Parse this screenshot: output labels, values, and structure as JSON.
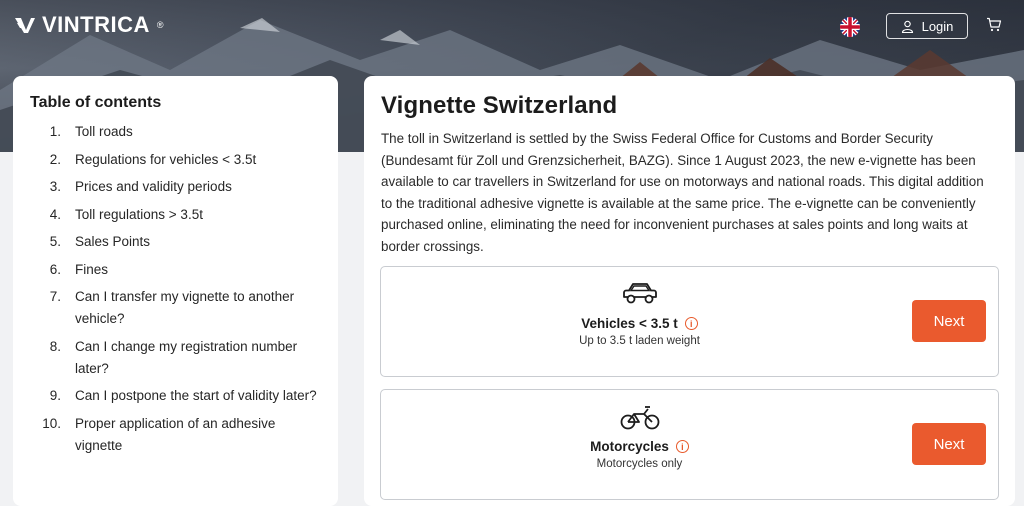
{
  "header": {
    "logo_text": "VINTRICA",
    "logo_mark": "®",
    "login_label": "Login",
    "icons": [
      "vintrica-logo-icon",
      "uk-flag-icon",
      "user-icon",
      "cart-icon"
    ]
  },
  "toc": {
    "title": "Table of contents",
    "items": [
      {
        "num": "1.",
        "label": "Toll roads"
      },
      {
        "num": "2.",
        "label": "Regulations for vehicles < 3.5t"
      },
      {
        "num": "3.",
        "label": "Prices and validity periods"
      },
      {
        "num": "4.",
        "label": "Toll regulations > 3.5t"
      },
      {
        "num": "5.",
        "label": "Sales Points"
      },
      {
        "num": "6.",
        "label": "Fines"
      },
      {
        "num": "7.",
        "label": "Can I transfer my vignette to another vehicle?"
      },
      {
        "num": "8.",
        "label": "Can I change my registration number later?"
      },
      {
        "num": "9.",
        "label": "Can I postpone the start of validity later?"
      },
      {
        "num": "10.",
        "label": "Proper application of an adhesive vignette"
      }
    ]
  },
  "main": {
    "title": "Vignette Switzerland",
    "intro": "The toll in Switzerland is settled by the Swiss Federal Office for Customs and Border Security (Bundesamt für Zoll und Grenzsicherheit, BAZG). Since 1 August 2023, the new e-vignette has been available to car travellers in Switzerland for use on motorways and national roads. This digital addition to the traditional adhesive vignette is available at the same price. The e-vignette can be conveniently purchased online, eliminating the need for inconvenient purchases at sales points and long waits at border crossings.",
    "vehicles": [
      {
        "title": "Vehicles < 3.5 t",
        "subtitle": "Up to 3.5 t laden weight",
        "button": "Next",
        "icon": "car-icon"
      },
      {
        "title": "Motorcycles",
        "subtitle": "Motorcycles only",
        "button": "Next",
        "icon": "motorcycle-icon"
      }
    ]
  },
  "colors": {
    "accent": "#ea5a2e",
    "page_bg": "#f1f2f4",
    "card_bg": "#ffffff"
  }
}
